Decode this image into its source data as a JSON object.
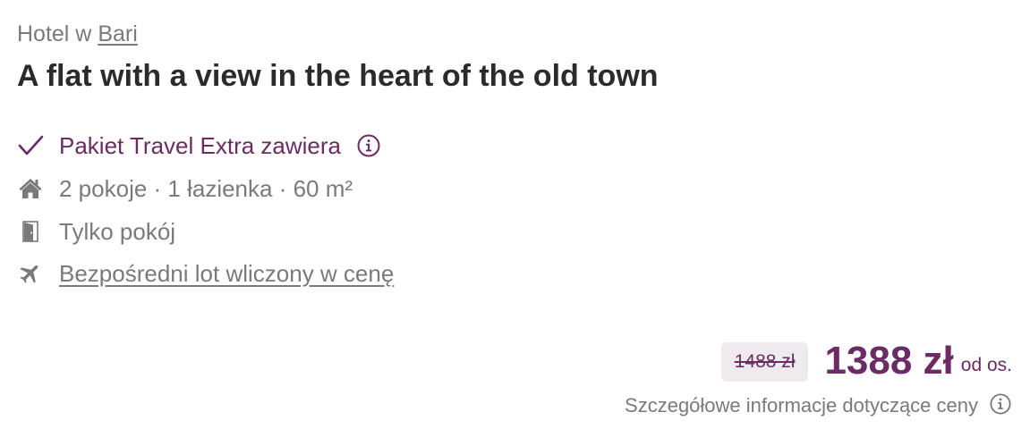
{
  "header": {
    "location_prefix": "Hotel w",
    "location_city": "Bari",
    "title": "A flat with a view in the heart of the old town"
  },
  "features": {
    "package": {
      "label": "Pakiet Travel Extra zawiera",
      "icon": "checkmark-icon",
      "info_icon": "info-icon"
    },
    "rooms": {
      "label": "2 pokoje · 1 łazienka · 60 m²",
      "icon": "house-icon"
    },
    "board": {
      "label": "Tylko pokój",
      "icon": "door-icon"
    },
    "flight": {
      "label": "Bezpośredni lot wliczony w cenę",
      "icon": "airplane-icon"
    }
  },
  "price": {
    "old": "1488 zł",
    "current": "1388 zł",
    "per_person": "od os.",
    "details_label": "Szczegółowe informacje dotyczące ceny"
  },
  "colors": {
    "accent": "#6a2c63",
    "muted_text": "#7a7a7a",
    "heading": "#2b2b2b",
    "old_price_bg": "#efeaee"
  }
}
